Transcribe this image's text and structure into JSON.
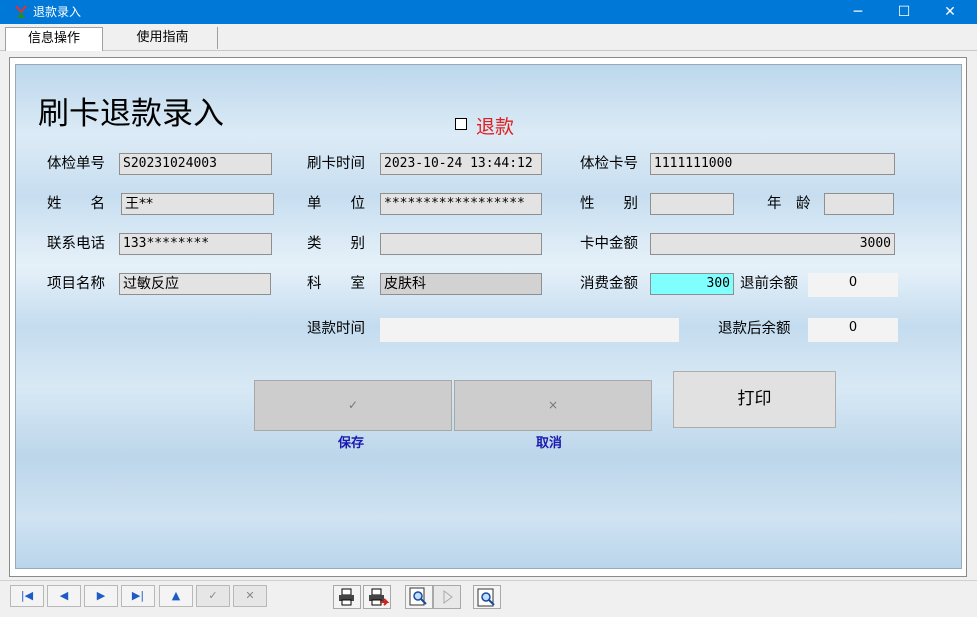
{
  "window": {
    "title": "退款录入",
    "controls": [
      "─",
      "☐",
      "✕"
    ]
  },
  "tabs": [
    {
      "label": "信息操作"
    },
    {
      "label": "使用指南"
    }
  ],
  "form": {
    "heading": "刷卡退款录入",
    "refund_checkbox_label": "退款",
    "labels": {
      "exam_no": "体检单号",
      "card_time": "刷卡时间",
      "card_no": "体检卡号",
      "name": "姓　　名",
      "unit": "单　　位",
      "gender": "性　　别",
      "age": "年　龄",
      "phone": "联系电话",
      "category": "类　　别",
      "card_balance": "卡中金额",
      "item_name": "项目名称",
      "dept": "科　　室",
      "consume_amount": "消费金额",
      "before_balance": "退前余额",
      "refund_time": "退款时间",
      "after_balance": "退款后余额"
    },
    "values": {
      "exam_no": "S20231024003",
      "card_time": "2023-10-24 13:44:12",
      "card_no": "1111111000",
      "name": "王**",
      "unit": "******************",
      "gender": "",
      "age": "",
      "phone": "133********",
      "category": "",
      "card_balance": "3000",
      "item_name": "过敏反应",
      "dept": "皮肤科",
      "consume_amount": "300",
      "before_balance": "0",
      "refund_time": "",
      "after_balance": "0"
    }
  },
  "buttons": {
    "save_icon": "✓",
    "save_label": "保存",
    "cancel_icon": "×",
    "cancel_label": "取消",
    "print_label": "打印"
  },
  "navbar": {
    "first": "|◀",
    "prev": "◀",
    "next": "▶",
    "last": "▶|",
    "up": "▲",
    "confirm": "✓",
    "cancel": "✕"
  },
  "colors": {
    "titlebar": "#0078d7",
    "highlight_field": "#80ffff",
    "refund_label": "#e02020",
    "button_caption": "#1a1ab0"
  }
}
